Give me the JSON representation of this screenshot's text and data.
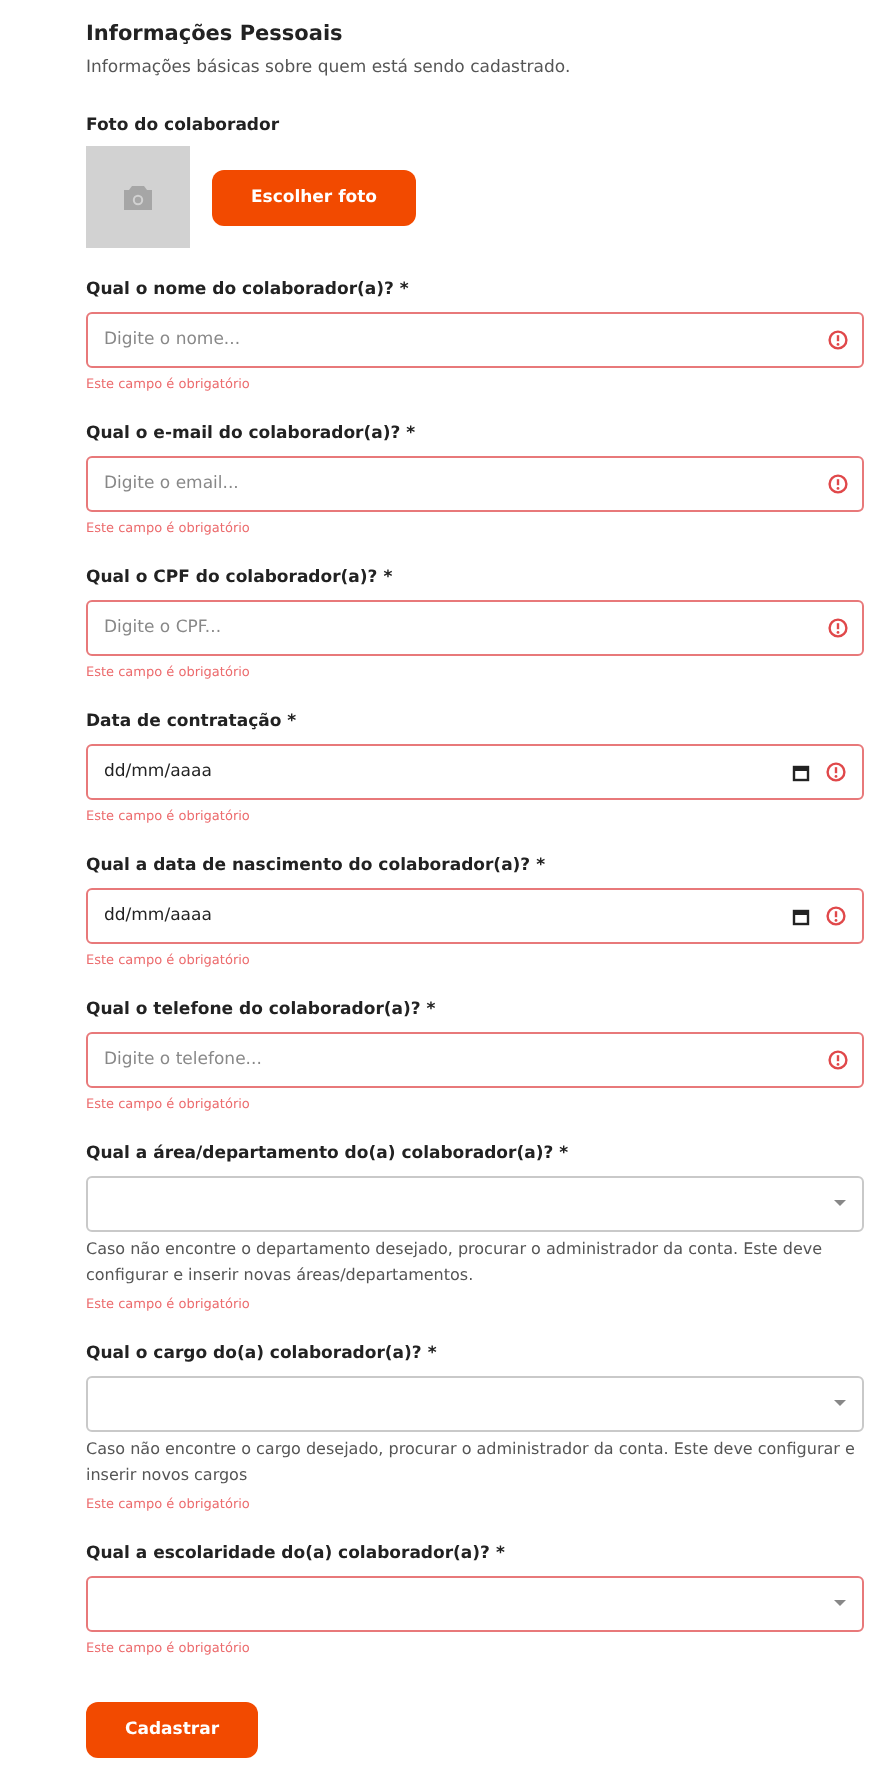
{
  "section": {
    "title": "Informações Pessoais",
    "subtitle": "Informações básicas sobre quem está sendo cadastrado."
  },
  "photo": {
    "label": "Foto do colaborador",
    "button": "Escolher foto"
  },
  "fields": [
    {
      "kind": "text",
      "label": "Qual o nome do colaborador(a)? *",
      "placeholder": "Digite o nome...",
      "invalid": true,
      "error": "Este campo é obrigatório"
    },
    {
      "kind": "text",
      "label": "Qual o e-mail do colaborador(a)? *",
      "placeholder": "Digite o email...",
      "invalid": true,
      "error": "Este campo é obrigatório"
    },
    {
      "kind": "text",
      "label": "Qual o CPF do colaborador(a)? *",
      "placeholder": "Digite o CPF...",
      "invalid": true,
      "error": "Este campo é obrigatório"
    },
    {
      "kind": "date",
      "label": "Data de contratação *",
      "value": "dd/mm/aaaa",
      "invalid": true,
      "error": "Este campo é obrigatório"
    },
    {
      "kind": "date",
      "label": "Qual a data de nascimento do colaborador(a)? *",
      "value": "dd/mm/aaaa",
      "invalid": true,
      "error": "Este campo é obrigatório"
    },
    {
      "kind": "text",
      "label": "Qual o telefone do colaborador(a)? *",
      "placeholder": "Digite o telefone...",
      "invalid": true,
      "error": "Este campo é obrigatório"
    },
    {
      "kind": "select",
      "label": "Qual a área/departamento do(a) colaborador(a)? *",
      "invalid": false,
      "hint": "Caso não encontre o departamento desejado, procurar o administrador da conta. Este deve configurar e inserir novas áreas/departamentos.",
      "error": "Este campo é obrigatório"
    },
    {
      "kind": "select",
      "label": "Qual o cargo do(a) colaborador(a)? *",
      "invalid": false,
      "hint": "Caso não encontre o cargo desejado, procurar o administrador da conta. Este deve configurar e inserir novos cargos",
      "error": "Este campo é obrigatório"
    },
    {
      "kind": "select",
      "label": "Qual a escolaridade do(a) colaborador(a)? *",
      "invalid": true,
      "error": "Este campo é obrigatório"
    }
  ],
  "submit": "Cadastrar"
}
